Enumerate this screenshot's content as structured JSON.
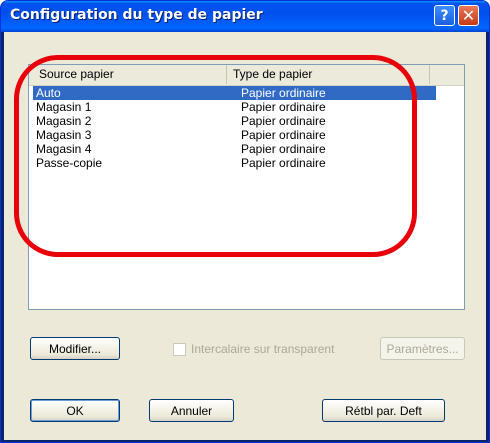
{
  "window": {
    "title": "Configuration du type de papier",
    "help_glyph": "?",
    "close_glyph": "✕"
  },
  "list": {
    "columns": [
      "Source papier",
      "Type de papier"
    ],
    "rows": [
      {
        "source": "Auto",
        "type": "Papier ordinaire",
        "selected": true
      },
      {
        "source": "Magasin 1",
        "type": "Papier ordinaire"
      },
      {
        "source": "Magasin 2",
        "type": "Papier ordinaire"
      },
      {
        "source": "Magasin 3",
        "type": "Papier ordinaire"
      },
      {
        "source": "Magasin 4",
        "type": "Papier ordinaire"
      },
      {
        "source": "Passe-copie",
        "type": "Papier ordinaire"
      }
    ]
  },
  "controls": {
    "modifier_label": "Modifier...",
    "intercalaire_label": "Intercalaire sur transparent",
    "parametres_label": "Paramètres...",
    "ok_label": "OK",
    "annuler_label": "Annuler",
    "retbl_label": "Rétbl par. Deft"
  },
  "colors": {
    "selection": "#316ac5",
    "highlight_ring": "#e8000b"
  }
}
